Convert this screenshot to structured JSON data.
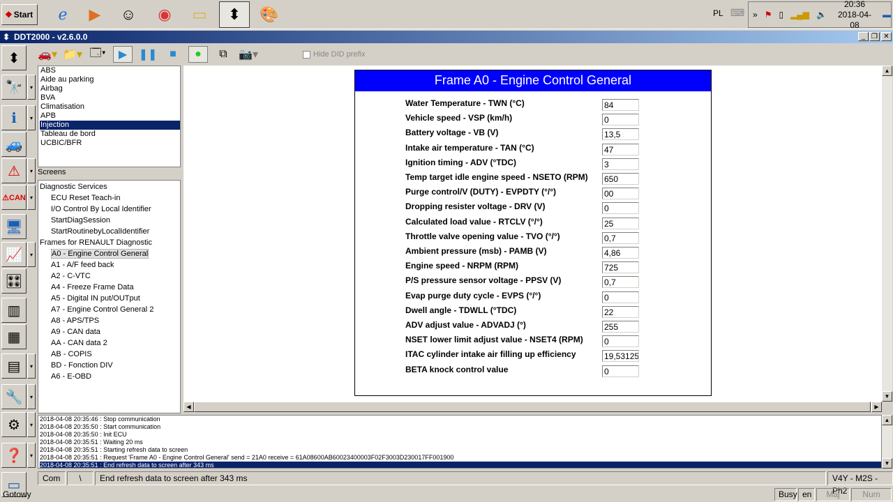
{
  "taskbar": {
    "start": "Start",
    "lang": "PL",
    "time": "20:36",
    "date": "2018-04-08"
  },
  "window": {
    "title": "DDT2000 - v2.6.0.0"
  },
  "toolbar": {
    "hide_did": "Hide DID prefix"
  },
  "ecus": [
    "ABS",
    "Aide au parking",
    "Airbag",
    "BVA",
    "Climatisation",
    "APB",
    "Injection",
    "Tableau de bord",
    "UCBIC/BFR"
  ],
  "ecu_selected": 6,
  "screens_label": "Screens",
  "tree": {
    "groups": [
      {
        "label": "Diagnostic Services",
        "items": [
          "ECU Reset Teach-in",
          "I/O Control By Local Identifier",
          "StartDiagSession",
          "StartRoutinebyLocalIdentifier"
        ]
      },
      {
        "label": "Frames for RENAULT Diagnostic",
        "items": [
          "A0 - Engine Control General",
          "A1 - A/F feed back",
          "A2 - C-VTC",
          "A4 - Freeze Frame Data",
          "A5 - Digital IN put/OUTput",
          "A7 - Engine Control General 2",
          "A8 - APS/TPS",
          "A9 - CAN data",
          "AA - CAN data 2",
          "AB - COPIS",
          "BD - Fonction DIV",
          "A6 - E-OBD"
        ]
      }
    ]
  },
  "frame": {
    "title": "Frame A0 - Engine Control General",
    "rows": [
      {
        "label": "Water Temperature - TWN (°C)",
        "value": "84"
      },
      {
        "label": "Vehicle speed - VSP (km/h)",
        "value": "0"
      },
      {
        "label": "Battery voltage - VB (V)",
        "value": "13,5"
      },
      {
        "label": "Intake air temperature - TAN (°C)",
        "value": "47"
      },
      {
        "label": "Ignition timing - ADV (°TDC)",
        "value": "3"
      },
      {
        "label": "Temp target idle engine speed - NSETO (RPM)",
        "value": "650"
      },
      {
        "label": "Purge control/V (DUTY) - EVPDTY (°/°)",
        "value": "00"
      },
      {
        "label": "Dropping resister voltage - DRV (V)",
        "value": "0"
      },
      {
        "label": "Calculated load value - RTCLV (°/°)",
        "value": "25"
      },
      {
        "label": "Throttle valve opening value - TVO (°/°)",
        "value": "0,7"
      },
      {
        "label": "Ambient pressure (msb) - PAMB (V)",
        "value": "4,86"
      },
      {
        "label": "Engine speed - NRPM (RPM)",
        "value": "725"
      },
      {
        "label": "P/S pressure sensor voltage - PPSV (V)",
        "value": "0,7"
      },
      {
        "label": "Evap purge duty cycle - EVPS (°/°)",
        "value": "0"
      },
      {
        "label": "Dwell angle - TDWLL (°TDC)",
        "value": "22"
      },
      {
        "label": "ADV adjust value - ADVADJ (°)",
        "value": "255"
      },
      {
        "label": "NSET lower limit adjust value - NSET4 (RPM)",
        "value": "0"
      },
      {
        "label": "ITAC cylinder intake air filling up efficiency",
        "value": "19,53125"
      },
      {
        "label": "BETA knock control value",
        "value": "0"
      }
    ]
  },
  "log": [
    "2018-04-08 20:35:46 : Stop communication",
    "2018-04-08 20:35:50 : Start communication",
    "2018-04-08 20:35:50 : Init ECU",
    "2018-04-08 20:35:51 : Waiting 20 ms",
    "2018-04-08 20:35:51 : Starting refresh data to screen",
    "2018-04-08 20:35:51 : Request 'Frame A0 - Engine Control General' send = 21A0 receive = 61A08600AB60023400003F02F3003D230017FF001900",
    "2018-04-08 20:35:51 : End refresh data to screen after 343 ms"
  ],
  "status": {
    "com": "Com",
    "spinner": "\\",
    "message": "End refresh data to screen after 343 ms",
    "vehicle": "V4Y - M2S - Ph2"
  },
  "bottom": {
    "ready": "Gotowy",
    "busy": "Busy",
    "lang": "en",
    "maj": "Maj",
    "num": "Num"
  },
  "colors": {
    "frame_header": "#0000ff",
    "selection": "#0a246a"
  }
}
